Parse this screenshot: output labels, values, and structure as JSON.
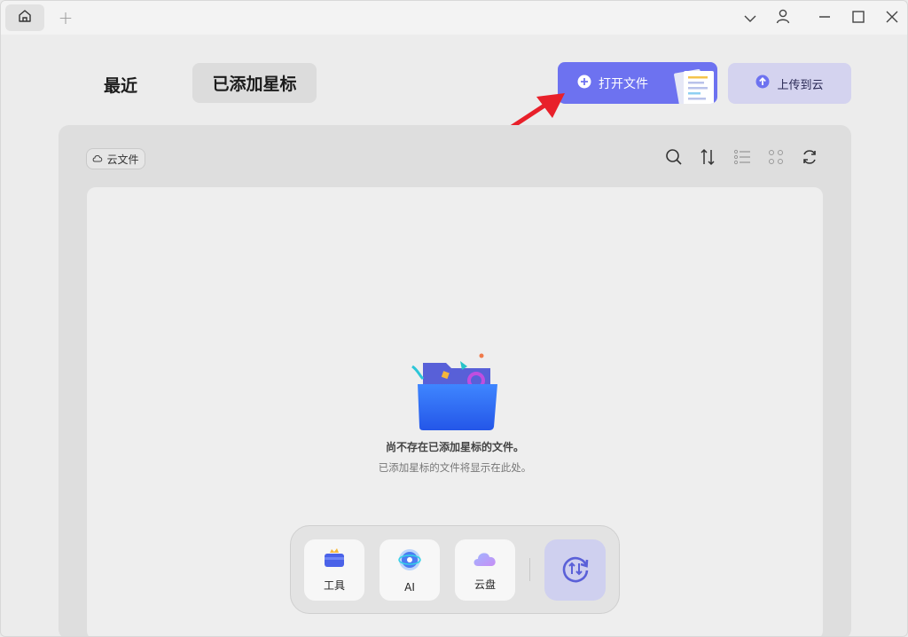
{
  "titlebar": {
    "home_icon": "home-icon",
    "add_tab_glyph": "+",
    "controls": [
      "chevron-down-icon",
      "user-icon",
      "minimize-icon",
      "maximize-icon",
      "close-icon"
    ]
  },
  "tabs": {
    "recent": "最近",
    "starred": "已添加星标"
  },
  "actions": {
    "open_file": "打开文件",
    "upload_cloud": "上传到云"
  },
  "toolbar": {
    "cloud_files": "云文件",
    "tools": [
      "search-icon",
      "sort-icon",
      "list-view-icon",
      "grid-view-icon",
      "refresh-icon"
    ]
  },
  "empty_state": {
    "title": "尚不存在已添加星标的文件。",
    "subtitle": "已添加星标的文件将显示在此处。"
  },
  "dock": {
    "items": [
      {
        "label": "工具",
        "icon": "toolbox-icon"
      },
      {
        "label": "AI",
        "icon": "ai-icon"
      },
      {
        "label": "云盘",
        "icon": "cloud-drive-icon"
      }
    ],
    "sync_icon": "sync-icon"
  },
  "colors": {
    "accent": "#6d72f0",
    "upload_bg": "#d4d3ef",
    "annotation_arrow": "#e8202a"
  }
}
